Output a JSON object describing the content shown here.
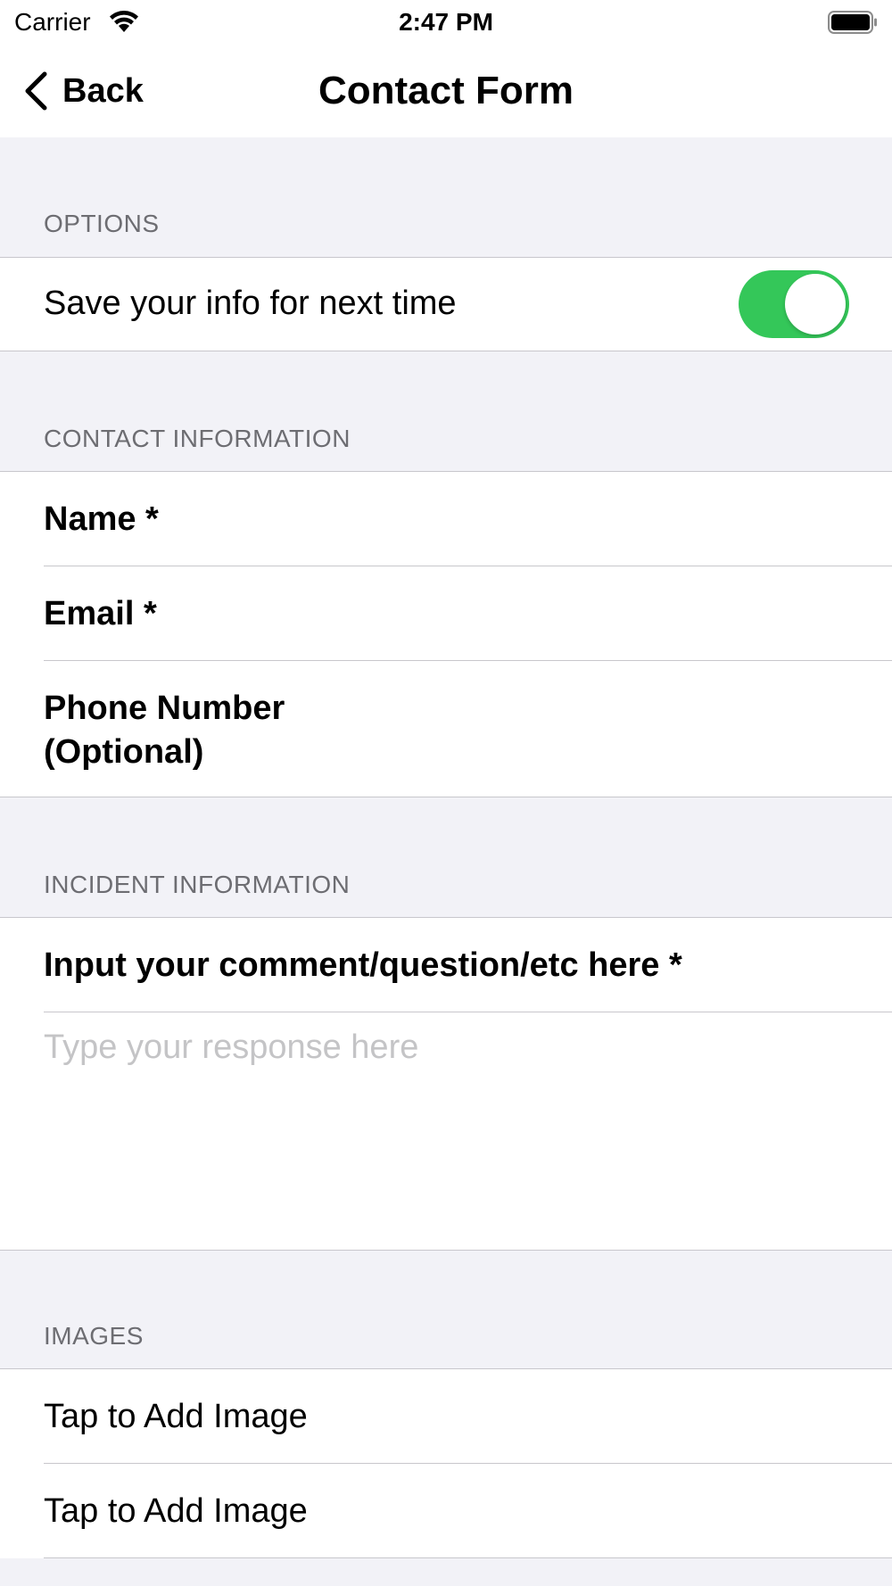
{
  "status_bar": {
    "carrier": "Carrier",
    "time": "2:47 PM"
  },
  "nav": {
    "back_label": "Back",
    "title": "Contact Form"
  },
  "options": {
    "header": "OPTIONS",
    "save_info_label": "Save your info for next time",
    "save_info_on": true,
    "toggle_color": "#34c759"
  },
  "contact": {
    "header": "CONTACT INFORMATION",
    "name_label": "Name *",
    "email_label": "Email *",
    "phone_label_line1": "Phone Number",
    "phone_label_line2": "(Optional)"
  },
  "incident": {
    "header": "INCIDENT INFORMATION",
    "comment_label": "Input your comment/question/etc here *",
    "response_placeholder": "Type your response here",
    "response_value": ""
  },
  "images": {
    "header": "IMAGES",
    "items": [
      {
        "label": "Tap to Add Image"
      },
      {
        "label": "Tap to Add Image"
      }
    ]
  }
}
